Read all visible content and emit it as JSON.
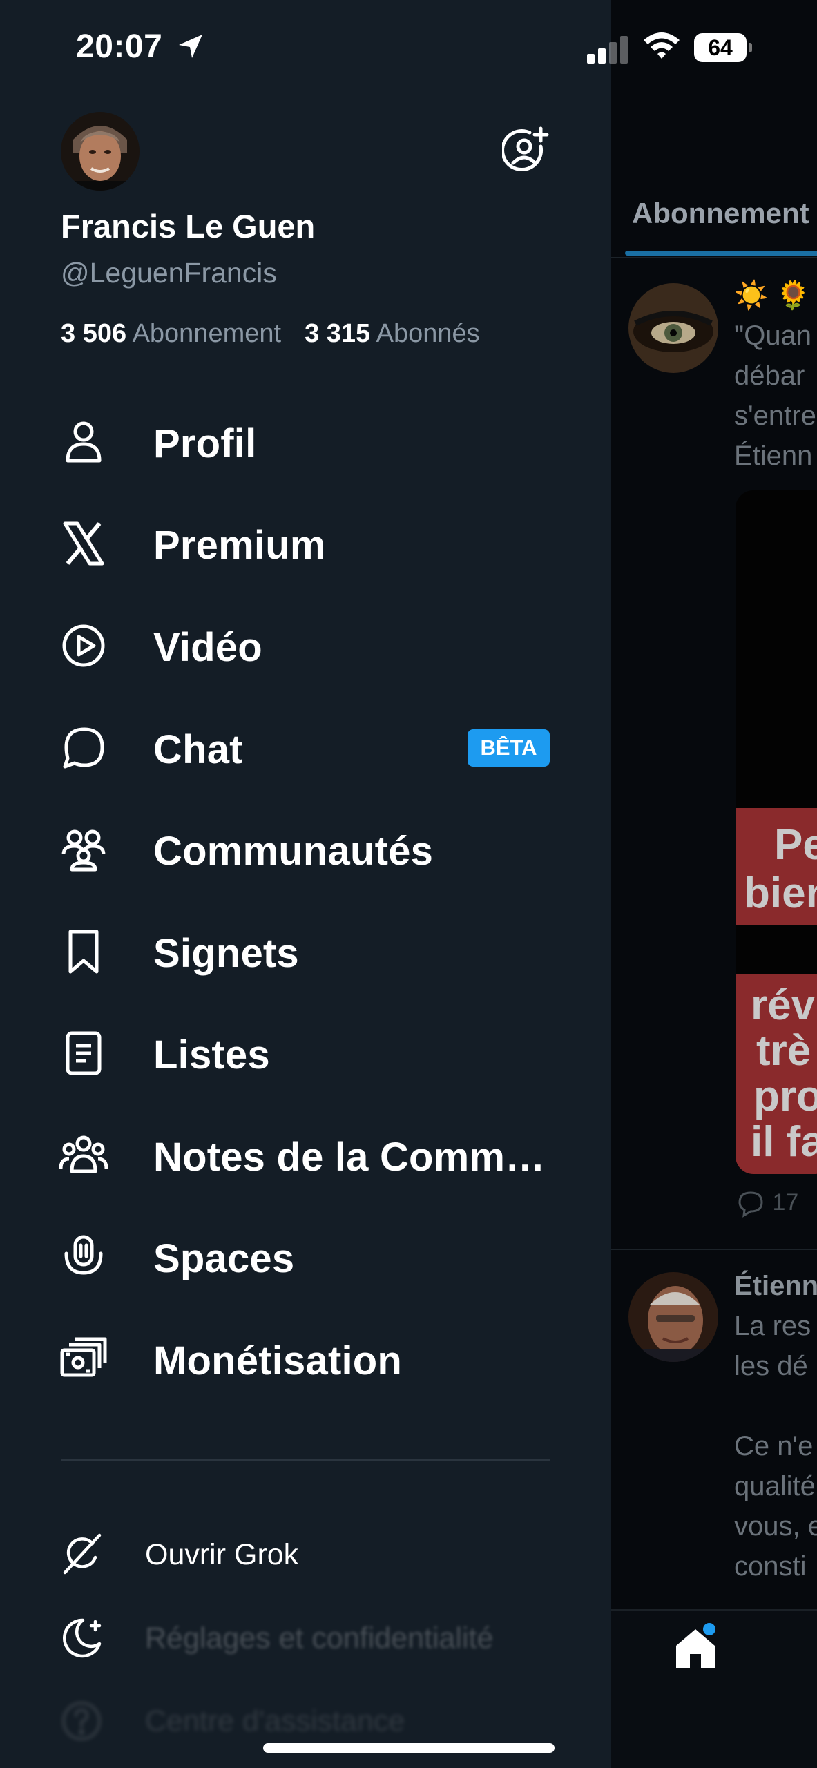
{
  "status_bar": {
    "time": "20:07",
    "battery": "64",
    "icons": [
      "location-arrow-icon",
      "cellular-signal-icon",
      "wifi-icon",
      "battery-icon"
    ]
  },
  "profile": {
    "display_name": "Francis Le Guen",
    "handle": "@LeguenFrancis",
    "following_count": "3 506",
    "following_label": "Abonnement",
    "followers_count": "3 315",
    "followers_label": "Abonnés"
  },
  "menu": {
    "items": [
      {
        "label": "Profil",
        "icon": "person-icon"
      },
      {
        "label": "Premium",
        "icon": "x-logo-icon"
      },
      {
        "label": "Vidéo",
        "icon": "play-circle-icon"
      },
      {
        "label": "Chat",
        "icon": "chat-bubble-icon",
        "badge": "BÊTA"
      },
      {
        "label": "Communautés",
        "icon": "communities-icon"
      },
      {
        "label": "Signets",
        "icon": "bookmark-icon"
      },
      {
        "label": "Listes",
        "icon": "list-icon"
      },
      {
        "label": "Notes de la Comm…",
        "icon": "community-notes-icon"
      },
      {
        "label": "Spaces",
        "icon": "spaces-microphone-icon"
      },
      {
        "label": "Monétisation",
        "icon": "monetization-icon"
      }
    ],
    "secondary": [
      {
        "label": "Ouvrir Grok",
        "icon": "grok-icon"
      },
      {
        "label": "Réglages et confidentialité",
        "icon": "moon-icon"
      },
      {
        "label": "Centre d'assistance",
        "icon": "help-icon"
      }
    ]
  },
  "feed": {
    "tab_label": "Abonnement",
    "post1_lines": [
      "☀️ 🌻",
      "\"Quan",
      "débar",
      "s'entre",
      "Étienn"
    ],
    "post1_media_lines": [
      "Pe",
      "bien",
      "rév",
      "trè",
      "pro",
      "il fa"
    ],
    "post1_reply_count": "17",
    "post2_name": "Étienn",
    "post2_lines": [
      "La res",
      "les dé",
      "",
      "Ce n'e",
      "qualité",
      "vous, e",
      "consti"
    ]
  },
  "colors": {
    "drawer_bg": "#141d26",
    "accent": "#1d9bf0",
    "muted_text": "#8b98a5"
  }
}
